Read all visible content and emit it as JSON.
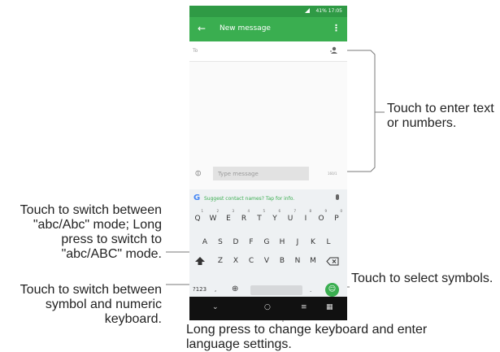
{
  "status_bar": {
    "text": "41% 17:05"
  },
  "app_bar": {
    "back_icon": "back-arrow-icon",
    "title": "New message",
    "menu_icon": "overflow-menu-icon"
  },
  "to_field": {
    "placeholder": "To"
  },
  "compose": {
    "placeholder": "Type message",
    "counter": "160/1"
  },
  "suggestion_bar": {
    "text": "Suggest contact names? Tap for info."
  },
  "keyboard": {
    "row1": [
      "Q",
      "W",
      "E",
      "R",
      "T",
      "Y",
      "U",
      "I",
      "O",
      "P"
    ],
    "row1_hints": [
      "1",
      "2",
      "3",
      "4",
      "5",
      "6",
      "7",
      "8",
      "9",
      "0"
    ],
    "row2": [
      "A",
      "S",
      "D",
      "F",
      "G",
      "H",
      "J",
      "K",
      "L"
    ],
    "row3": [
      "Z",
      "X",
      "C",
      "V",
      "B",
      "N",
      "M"
    ],
    "symbols_key": "?123",
    "comma_key": ","
  },
  "callouts": {
    "enter_text": "Touch to enter text or numbers.",
    "switch_case": "Touch to switch between \"abc/Abc\" mode; Long press to switch to \"abc/ABC\" mode.",
    "switch_symbol": "Touch to switch between symbol and numeric keyboard.",
    "select_symbols": "Touch to select symbols.",
    "long_press_space": "Long press to change keyboard and enter language settings."
  },
  "colors": {
    "accent": "#3aae50",
    "statusbar": "#2f9a45",
    "google_blue": "#4285f4"
  }
}
